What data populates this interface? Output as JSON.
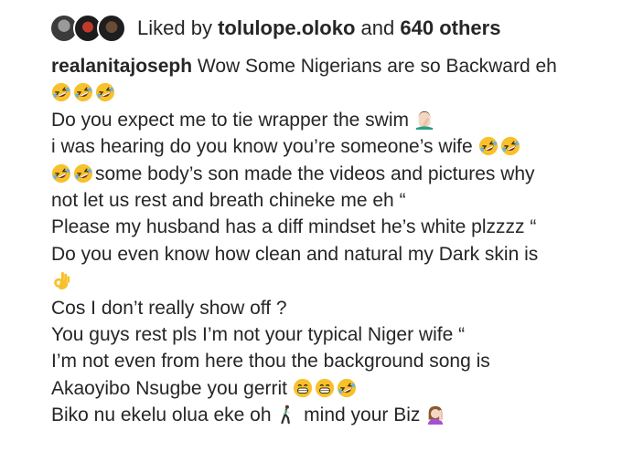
{
  "likes": {
    "prefix": "Liked by",
    "user": "tolulope.oloko",
    "conjunction": "and",
    "others": "640 others",
    "avatars": [
      "avatar-1",
      "avatar-2",
      "avatar-3"
    ]
  },
  "caption": {
    "username": "realanitajoseph",
    "first_text": " Wow Some Nigerians are so Backward eh",
    "lines": [
      "Do you expect me to tie wrapper the swim ",
      " i was hearing do you know you’re someone’s wife ",
      "some body’s son made the videos and pictures why",
      "not let us rest and breath chineke me eh “",
      "Please my husband has a diff mindset he’s white plzzzz “",
      "Do you even know how clean and natural my Dark skin is",
      "Cos I don’t really show off ?",
      "You guys rest pls I’m not your typical Niger wife “",
      "I’m not even from here thou the background song is",
      "Akaoyibo Nsugbe you gerrit ",
      "Biko nu ekelu olua eke oh ",
      " mind your Biz "
    ]
  },
  "icons": {
    "laughing": "rolling-on-floor-laughing-emoji",
    "facepalm": "man-facepalming-emoji",
    "ok_hand": "ok-hand-emoji",
    "grin": "grinning-face-emoji",
    "walking": "person-walking-emoji",
    "raising_hand": "woman-raising-hand-emoji"
  },
  "colors": {
    "text": "#262626",
    "emoji_yellow": "#f7c12b"
  }
}
